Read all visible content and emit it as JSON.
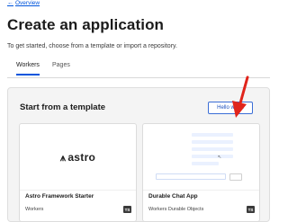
{
  "nav": {
    "back_label": "Overview",
    "back_arrow": "←"
  },
  "header": {
    "title": "Create an application",
    "subtitle": "To get started, choose from a template or import a repository."
  },
  "tabs": [
    {
      "label": "Workers",
      "active": true
    },
    {
      "label": "Pages",
      "active": false
    }
  ],
  "templates": {
    "title": "Start from a template",
    "hello_button": "Hello world",
    "cards": [
      {
        "name": "Astro Framework Starter",
        "tags": "Workers",
        "badge": "TS",
        "logo_text": "astro"
      },
      {
        "name": "Durable Chat App",
        "tags": "Workers   Durable Objects",
        "badge": "TS"
      }
    ]
  },
  "colors": {
    "accent": "#0055dc",
    "annotation_arrow": "#e0241b"
  },
  "icons": {
    "back": "arrow-left-icon",
    "astro": "astro-logo-icon",
    "badge": "typescript-badge"
  }
}
